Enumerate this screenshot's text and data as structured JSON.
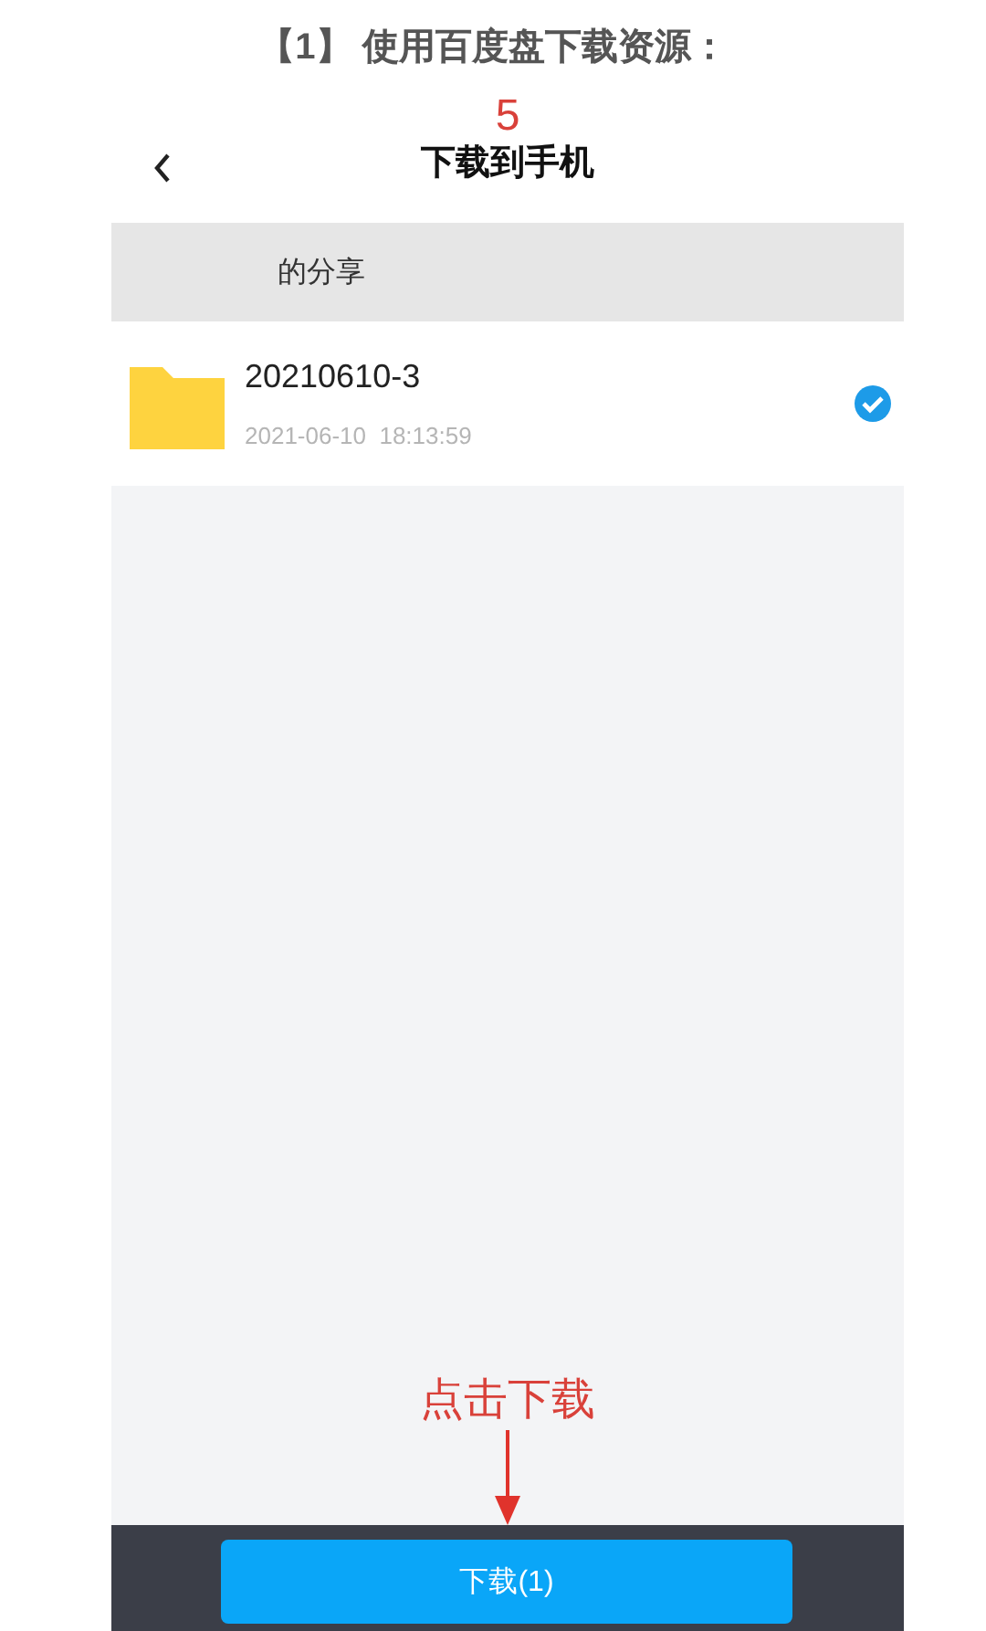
{
  "heading": "【1】 使用百度盘下载资源：",
  "annotations": {
    "step": "5",
    "hint": "点击下载"
  },
  "phone": {
    "title": "下载到手机",
    "breadcrumb": "的分享",
    "files": [
      {
        "name": "20210610-3",
        "date": "2021-06-10  18:13:59",
        "selected": true
      }
    ],
    "button": "下载(1)"
  }
}
